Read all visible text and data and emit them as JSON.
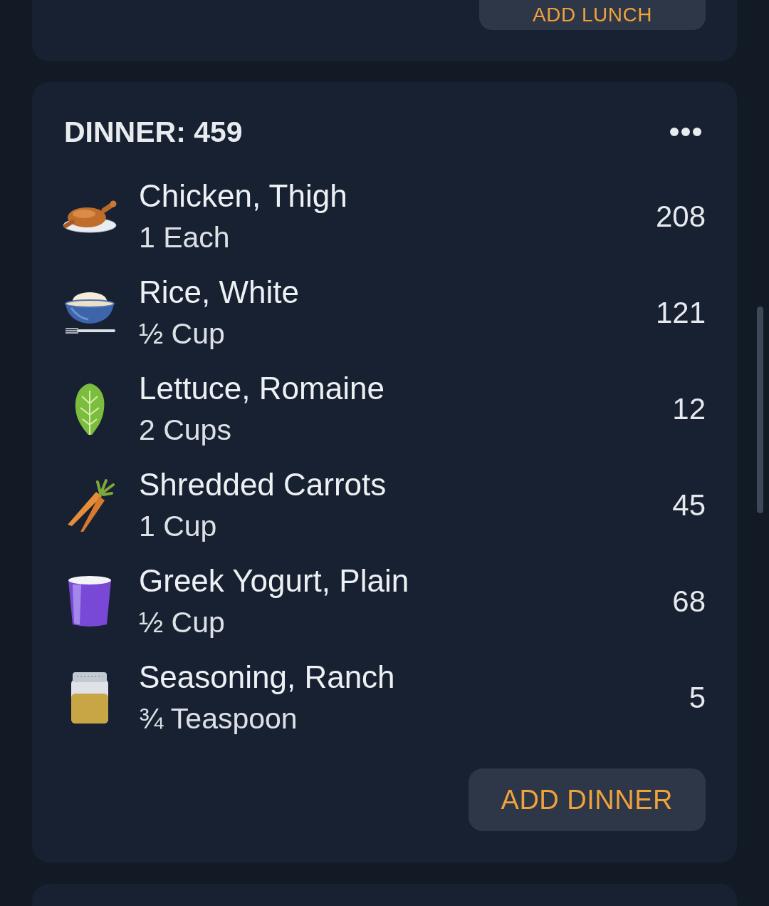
{
  "lunch": {
    "add_button": "ADD LUNCH"
  },
  "dinner": {
    "title": "DINNER: 459",
    "foods": [
      {
        "kind": "chicken",
        "name": "Chicken, Thigh",
        "quantity": "1 Each",
        "calories": "208"
      },
      {
        "kind": "rice",
        "name": "Rice, White",
        "quantity": "½ Cup",
        "calories": "121"
      },
      {
        "kind": "lettuce",
        "name": "Lettuce, Romaine",
        "quantity": "2 Cups",
        "calories": "12"
      },
      {
        "kind": "carrot",
        "name": "Shredded Carrots",
        "quantity": "1 Cup",
        "calories": "45"
      },
      {
        "kind": "yogurt",
        "name": "Greek Yogurt, Plain",
        "quantity": "½ Cup",
        "calories": "68"
      },
      {
        "kind": "seasoning",
        "name": "Seasoning, Ranch",
        "quantity": "¾ Teaspoon",
        "calories": "5"
      }
    ],
    "add_button": "ADD DINNER"
  }
}
